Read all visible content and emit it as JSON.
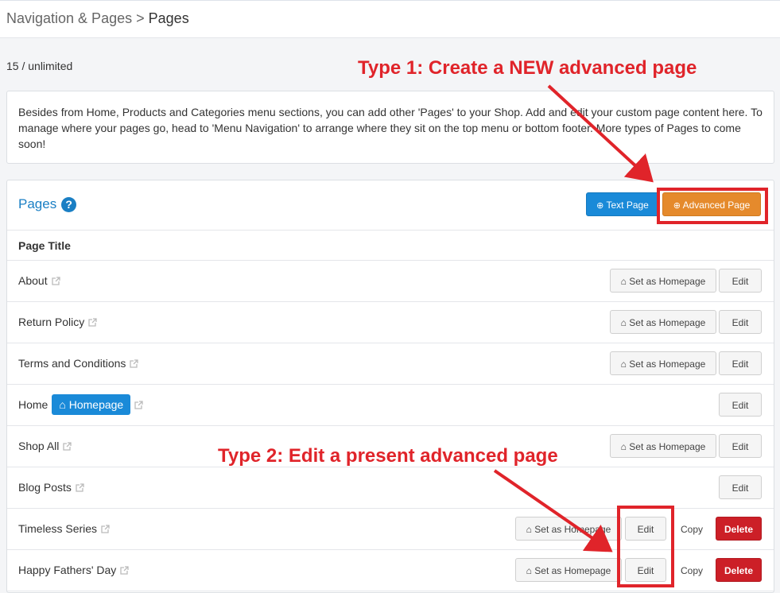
{
  "breadcrumb": {
    "parent": "Navigation & Pages",
    "separator": ">",
    "current": "Pages"
  },
  "count": "15 / unlimited",
  "info_text": "Besides from Home, Products and Categories menu sections, you can add other 'Pages' to your Shop. Add and edit your custom page content here. To manage where your pages go, head to 'Menu Navigation' to arrange where they sit on the top menu or bottom footer. More types of Pages to come soon!",
  "panel": {
    "title": "Pages",
    "help_symbol": "?",
    "text_page_label": "Text Page",
    "advanced_page_label": "Advanced Page",
    "column_header": "Page Title"
  },
  "row_labels": {
    "set_homepage": "Set as Homepage",
    "edit": "Edit",
    "copy": "Copy",
    "delete": "Delete",
    "homepage_badge": "Homepage"
  },
  "pages": [
    {
      "title": "About"
    },
    {
      "title": "Return Policy"
    },
    {
      "title": "Terms and Conditions"
    },
    {
      "title": "Home"
    },
    {
      "title": "Shop All"
    },
    {
      "title": "Blog Posts"
    },
    {
      "title": "Timeless Series"
    },
    {
      "title": "Happy Fathers' Day"
    }
  ],
  "annotations": {
    "type1": "Type 1: Create a NEW advanced page",
    "type2": "Type 2: Edit a present advanced page"
  },
  "colors": {
    "accent": "#1a8ad8",
    "orange": "#e58a2c",
    "danger": "#cc1f27",
    "annotation": "#e0242a"
  }
}
